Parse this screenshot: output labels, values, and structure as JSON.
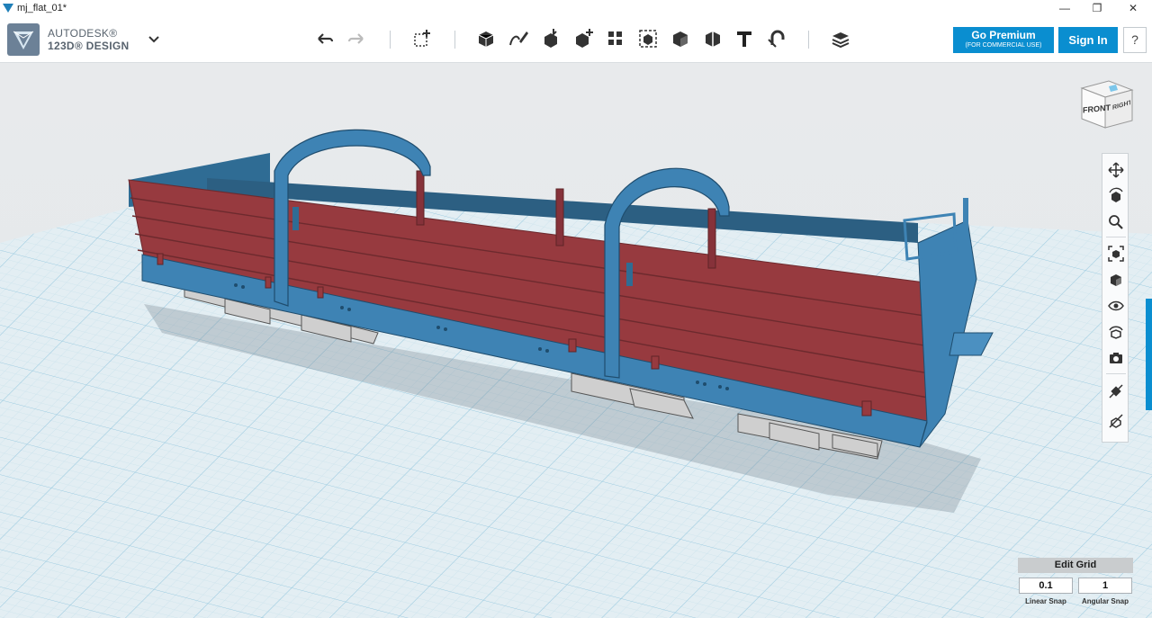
{
  "window": {
    "title": "mj_flat_01*",
    "controls": {
      "minimize": "—",
      "maximize": "❐",
      "close": "✕"
    }
  },
  "brand": {
    "line1": "AUTODESK®",
    "line2": "123D® DESIGN"
  },
  "toolbar": {
    "icons": [
      "undo-icon",
      "redo-icon",
      "transform-icon",
      "primitives-icon",
      "sketch-icon",
      "construct-icon",
      "modify-icon",
      "pattern-icon",
      "grouping-icon",
      "combine-icon",
      "measure-icon",
      "text-icon",
      "snap-icon",
      "materials-icon"
    ]
  },
  "buttons": {
    "premium_label": "Go Premium",
    "premium_sub": "(FOR COMMERCIAL USE)",
    "signin_label": "Sign In",
    "help_label": "?"
  },
  "viewcube": {
    "front_label": "FRONT",
    "right_label": "RIGHT"
  },
  "nav_tools": [
    "pan-icon",
    "orbit-icon",
    "zoom-icon",
    "fit-icon",
    "view-mode-icon",
    "visibility-icon",
    "materials-outline-icon",
    "screenshot-icon",
    "snap-grid-icon",
    "hide-icon"
  ],
  "grid_panel": {
    "title": "Edit Grid",
    "linear_snap_value": "0.1",
    "angular_snap_value": "1",
    "linear_snap_label": "Linear Snap",
    "angular_snap_label": "Angular Snap"
  },
  "colors": {
    "accent": "#0a8ed0",
    "wagon_side": "#973a3f",
    "wagon_frame": "#3e83b4",
    "grid_line": "#b7d8e6"
  }
}
